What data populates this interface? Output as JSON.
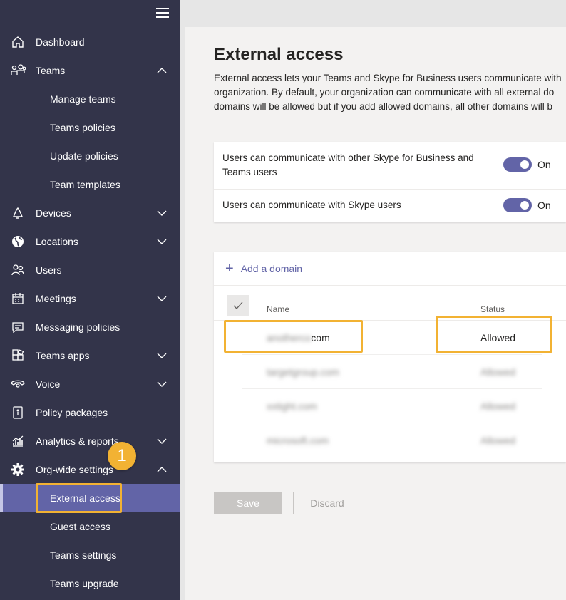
{
  "sidebar": {
    "items": [
      {
        "label": "Dashboard",
        "icon": "home-icon"
      },
      {
        "label": "Teams",
        "icon": "teams-icon",
        "chevron": "up"
      },
      {
        "label": "Manage teams"
      },
      {
        "label": "Teams policies"
      },
      {
        "label": "Update policies"
      },
      {
        "label": "Team templates"
      },
      {
        "label": "Devices",
        "icon": "bell-icon",
        "chevron": "down"
      },
      {
        "label": "Locations",
        "icon": "globe-icon",
        "chevron": "down"
      },
      {
        "label": "Users",
        "icon": "users-icon"
      },
      {
        "label": "Meetings",
        "icon": "calendar-icon",
        "chevron": "down"
      },
      {
        "label": "Messaging policies",
        "icon": "message-icon"
      },
      {
        "label": "Teams apps",
        "icon": "apps-icon",
        "chevron": "down"
      },
      {
        "label": "Voice",
        "icon": "voice-icon",
        "chevron": "down"
      },
      {
        "label": "Policy packages",
        "icon": "package-icon"
      },
      {
        "label": "Analytics & reports",
        "icon": "analytics-icon",
        "chevron": "down"
      },
      {
        "label": "Org-wide settings",
        "icon": "gear-icon",
        "chevron": "up"
      },
      {
        "label": "External access",
        "active": true
      },
      {
        "label": "Guest access"
      },
      {
        "label": "Teams settings"
      },
      {
        "label": "Teams upgrade"
      }
    ]
  },
  "main": {
    "title": "External access",
    "description": [
      "External access lets your Teams and Skype for Business users communicate with",
      "organization. By default, your organization can communicate with all external do",
      "domains will be allowed but if you add allowed domains, all other domains will b"
    ],
    "settings": [
      {
        "label": "Users can communicate with other Skype for Business and Teams users",
        "state": "On"
      },
      {
        "label": "Users can communicate with Skype users",
        "state": "On"
      }
    ],
    "add_domain_label": "Add a domain",
    "table": {
      "columns": [
        "Name",
        "Status"
      ],
      "rows": [
        {
          "name_blurred": "anotherco",
          "name_suffix": "com",
          "status": "Allowed"
        },
        {
          "name_blurred": "targetgroup.com",
          "status": "Allowed"
        },
        {
          "name_blurred": "xxtight.com",
          "status": "Allowed"
        },
        {
          "name_blurred": "microsoft.com",
          "status": "Allowed"
        }
      ]
    },
    "save_label": "Save",
    "discard_label": "Discard"
  },
  "annotation": {
    "step": "1"
  },
  "colors": {
    "sidebar_bg": "#33344a",
    "accent": "#6264a7",
    "highlight": "#f2b233",
    "main_bg": "#f3f2f1"
  }
}
